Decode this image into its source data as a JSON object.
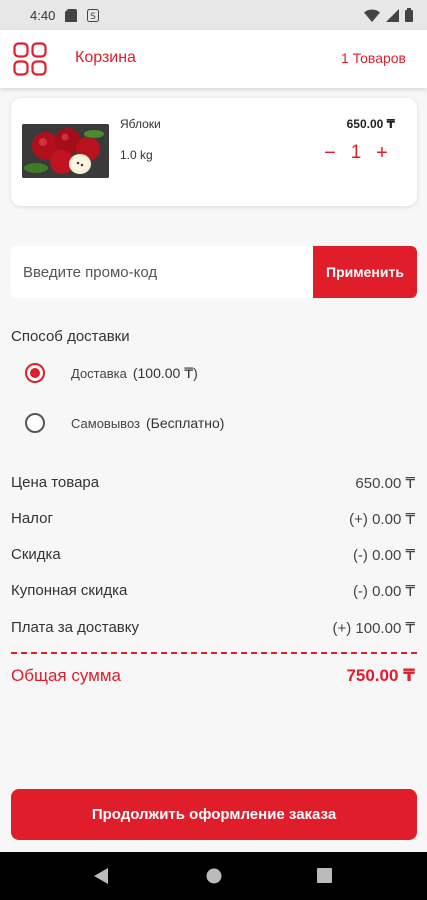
{
  "status_bar": {
    "time": "4:40"
  },
  "header": {
    "title": "Корзина",
    "items_count": "1 Товаров"
  },
  "cart": {
    "items": [
      {
        "name": "Яблоки",
        "weight": "1.0 kg",
        "price": "650.00 ₸",
        "quantity": "1",
        "decrement": "−",
        "increment": "+"
      }
    ]
  },
  "promo": {
    "placeholder": "Введите промо-код",
    "apply_label": "Применить"
  },
  "delivery": {
    "title": "Способ доставки",
    "options": [
      {
        "label": "Доставка",
        "extra": "(100.00 ₸)",
        "selected": true
      },
      {
        "label": "Самовывоз",
        "extra": "(Бесплатно)",
        "selected": false
      }
    ]
  },
  "summary": {
    "rows": [
      {
        "label": "Цена товара",
        "value": "650.00 ₸"
      },
      {
        "label": "Налог",
        "value": "(+) 0.00 ₸"
      },
      {
        "label": "Скидка",
        "value": "(-) 0.00 ₸"
      },
      {
        "label": "Купонная скидка",
        "value": "(-) 0.00 ₸"
      },
      {
        "label": "Плата за доставку",
        "value": "(+) 100.00 ₸"
      }
    ],
    "total_label": "Общая сумма",
    "total_value": "750.00 ₸"
  },
  "checkout_label": "Продолжить оформление заказа",
  "colors": {
    "accent": "#e01e2b",
    "background": "#f7f7f7"
  }
}
